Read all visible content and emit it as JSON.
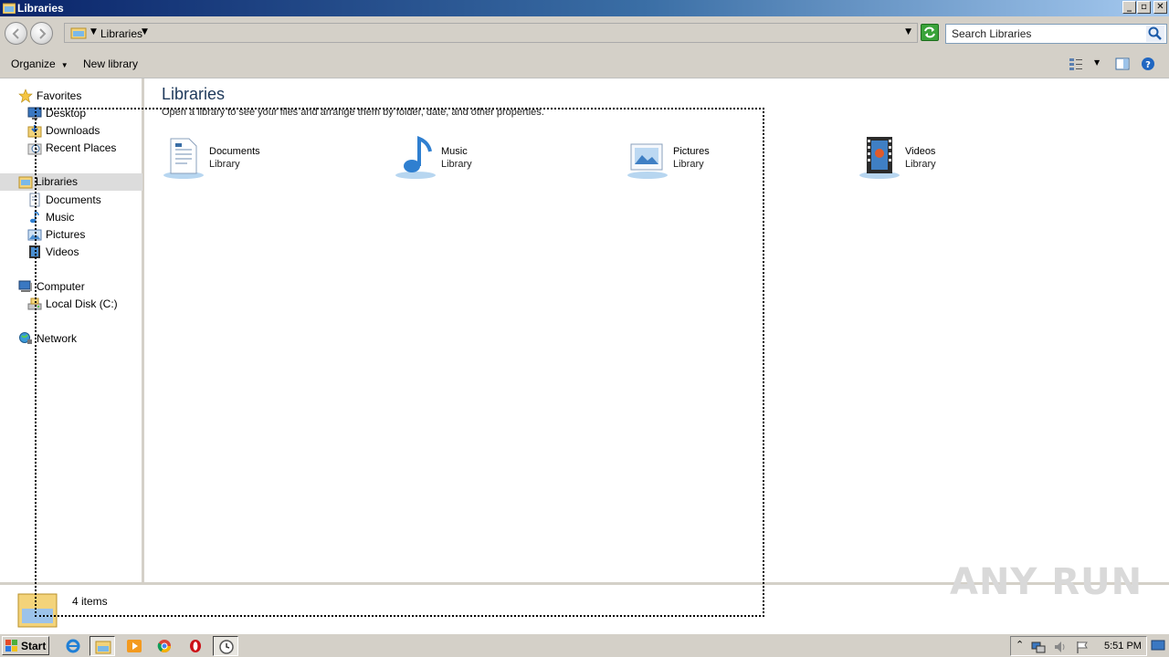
{
  "window": {
    "title": "Libraries",
    "buttons": [
      "minimize",
      "restore",
      "close"
    ]
  },
  "address": {
    "breadcrumb": "Libraries",
    "search_placeholder": "Search Libraries"
  },
  "toolbar": {
    "organize_label": "Organize",
    "new_library_label": "New library"
  },
  "nav": {
    "favorites": {
      "label": "Favorites",
      "items": [
        {
          "label": "Desktop",
          "icon": "desktop-icon"
        },
        {
          "label": "Downloads",
          "icon": "downloads-folder-icon"
        },
        {
          "label": "Recent Places",
          "icon": "recent-places-icon"
        }
      ]
    },
    "libraries": {
      "label": "Libraries",
      "selected": true,
      "items": [
        {
          "label": "Documents",
          "icon": "documents-icon"
        },
        {
          "label": "Music",
          "icon": "music-icon"
        },
        {
          "label": "Pictures",
          "icon": "pictures-icon"
        },
        {
          "label": "Videos",
          "icon": "videos-icon"
        }
      ]
    },
    "computer": {
      "label": "Computer",
      "items": [
        {
          "label": "Local Disk (C:)",
          "icon": "drive-icon"
        }
      ]
    },
    "network": {
      "label": "Network"
    }
  },
  "content": {
    "title": "Libraries",
    "subtitle": "Open a library to see your files and arrange them by folder, date, and other properties.",
    "libraries": [
      {
        "name": "Documents",
        "type": "Library",
        "icon": "documents-library-icon"
      },
      {
        "name": "Music",
        "type": "Library",
        "icon": "music-library-icon"
      },
      {
        "name": "Pictures",
        "type": "Library",
        "icon": "pictures-library-icon"
      },
      {
        "name": "Videos",
        "type": "Library",
        "icon": "videos-library-icon"
      }
    ]
  },
  "status": {
    "item_count": "4 items"
  },
  "watermark": "ANY RUN",
  "taskbar": {
    "start_label": "Start",
    "clock": "5:51 PM",
    "apps": [
      "internet-explorer-icon",
      "windows-explorer-icon",
      "media-player-icon",
      "chrome-icon",
      "opera-icon",
      "clock-app-icon"
    ]
  },
  "colors": {
    "titlebar_start": "#0a246a",
    "titlebar_end": "#a6caf0",
    "chrome_gray": "#d4d0c8",
    "content_title": "#1e395b"
  }
}
